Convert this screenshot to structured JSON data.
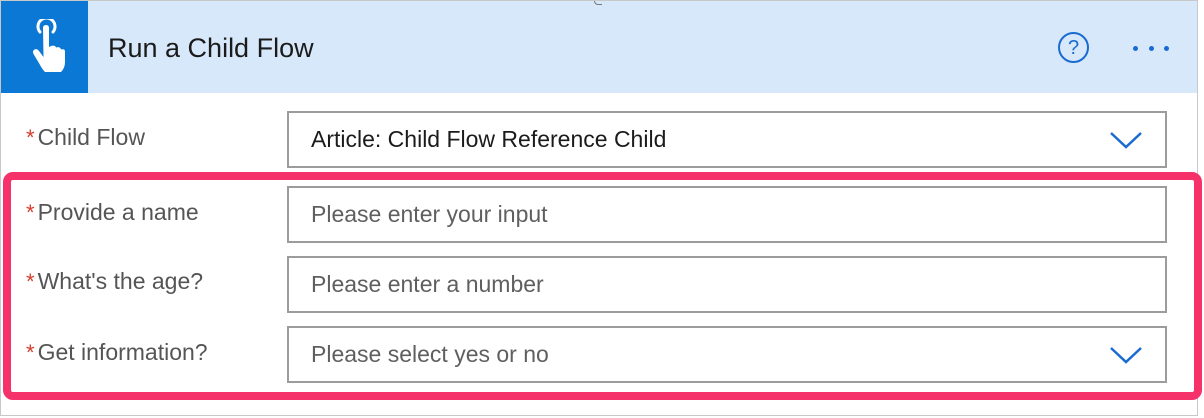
{
  "header": {
    "title": "Run a Child Flow",
    "help_glyph": "?",
    "colors": {
      "band": "#d7e8fa",
      "tile": "#0a78d4",
      "accent": "#1a6bd1"
    },
    "icons": [
      "touch-hand-icon",
      "help-circle-icon",
      "more-options-icon"
    ]
  },
  "fields": {
    "child_flow": {
      "required_mark": "*",
      "label": "Child Flow",
      "value": "Article: Child Flow Reference Child",
      "icon": "chevron-down-icon"
    },
    "name": {
      "required_mark": "*",
      "label": "Provide a name",
      "placeholder": "Please enter your input"
    },
    "age": {
      "required_mark": "*",
      "label": "What's the age?",
      "placeholder": "Please enter a number"
    },
    "info": {
      "required_mark": "*",
      "label": "Get information?",
      "placeholder": "Please select yes or no",
      "icon": "chevron-down-icon"
    }
  },
  "highlight": {
    "color": "#f5336a"
  }
}
